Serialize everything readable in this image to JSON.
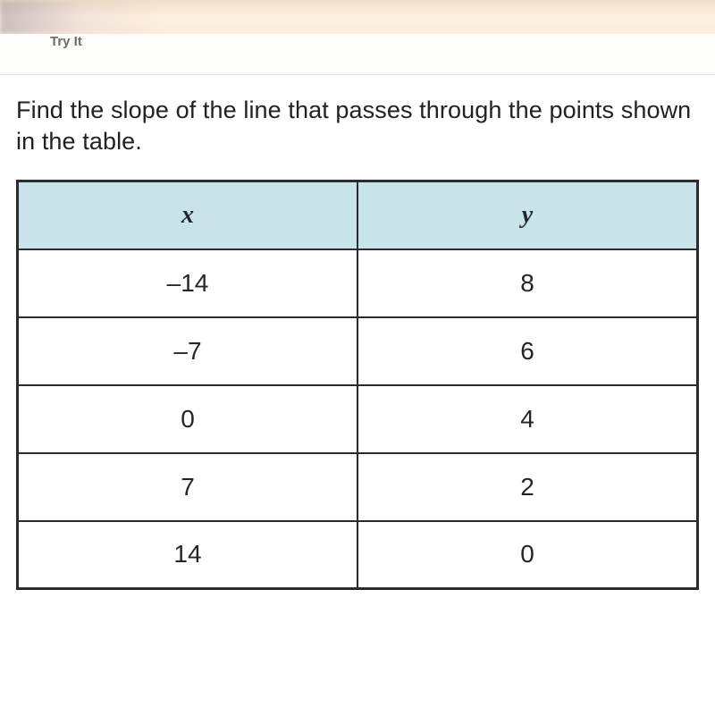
{
  "header": {
    "try_it": "Try It"
  },
  "prompt": "Find the slope of the line that passes through the points shown in the table.",
  "chart_data": {
    "type": "table",
    "columns": [
      "x",
      "y"
    ],
    "rows": [
      {
        "x": "–14",
        "y": "8"
      },
      {
        "x": "–7",
        "y": "6"
      },
      {
        "x": "0",
        "y": "4"
      },
      {
        "x": "7",
        "y": "2"
      },
      {
        "x": "14",
        "y": "0"
      }
    ]
  }
}
